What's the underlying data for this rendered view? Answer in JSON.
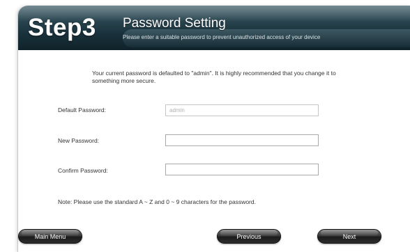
{
  "header": {
    "step": "Step3",
    "title": "Password Setting",
    "subtitle": "Please enter a suitable password to prevent unauthorized access of your device"
  },
  "intro": "Your current password is defaulted to \"admin\". It is highly recommended that you change it to something more secure.",
  "fields": [
    {
      "label": "Default Password:",
      "value": "admin",
      "placeholder": ""
    },
    {
      "label": "New Password:",
      "value": "",
      "placeholder": ""
    },
    {
      "label": "Confirm Password:",
      "value": "",
      "placeholder": ""
    }
  ],
  "note": "Note: Please use the standard A ~ Z and 0 ~ 9 characters for the password.",
  "buttons": {
    "main_menu": "Main Menu",
    "previous": "Previous",
    "next": "Next"
  }
}
